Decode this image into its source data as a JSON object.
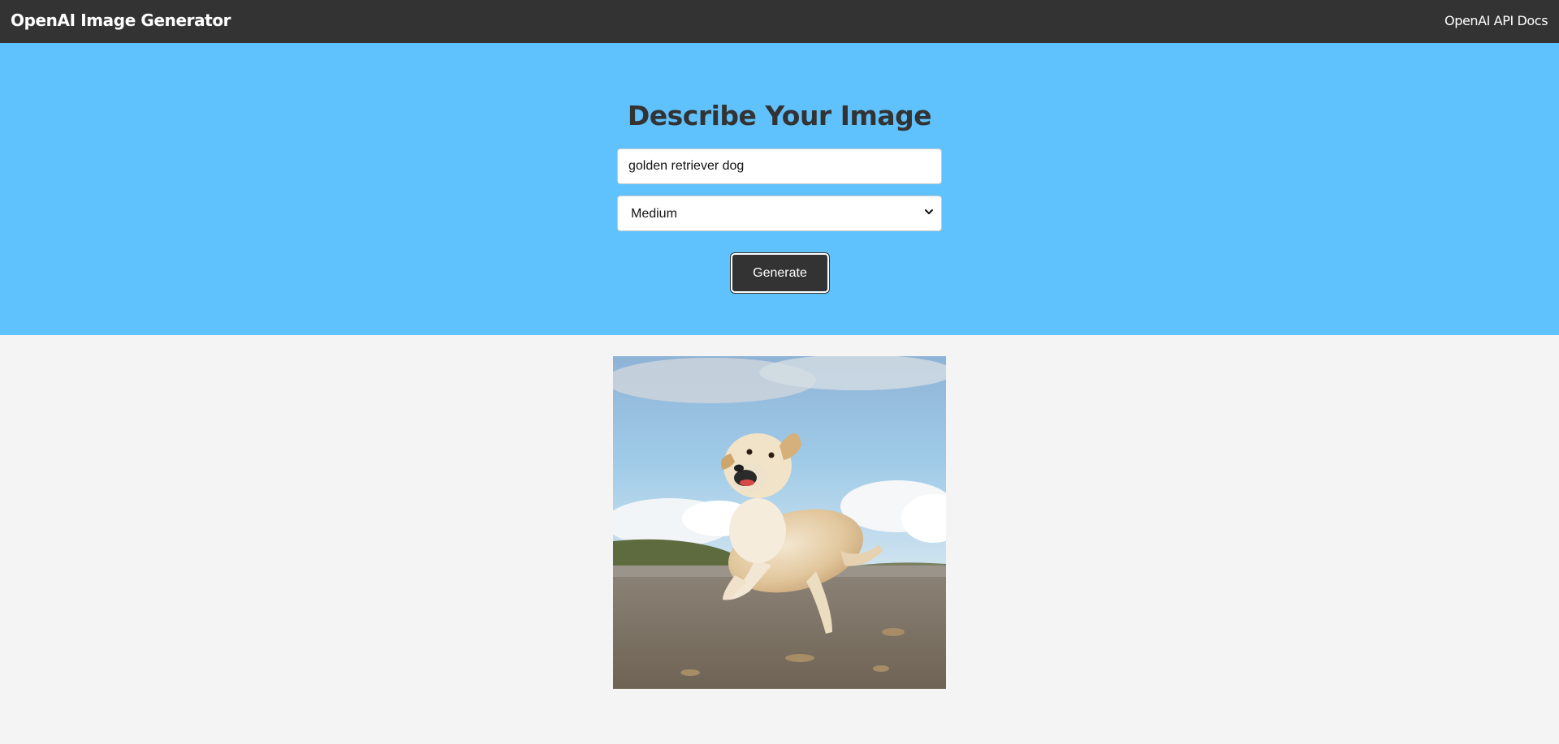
{
  "navbar": {
    "brand": "OpenAI Image Generator",
    "docs_link": "OpenAI API Docs"
  },
  "showcase": {
    "heading": "Describe Your Image",
    "prompt_value": "golden retriever dog",
    "size_select": {
      "selected": "Medium"
    },
    "generate_label": "Generate"
  },
  "colors": {
    "navbar_bg": "#333333",
    "showcase_bg": "#60c2fc",
    "page_bg": "#f4f4f4",
    "button_bg": "#333333"
  },
  "icons": {
    "select_arrow": "chevron-down-icon"
  }
}
